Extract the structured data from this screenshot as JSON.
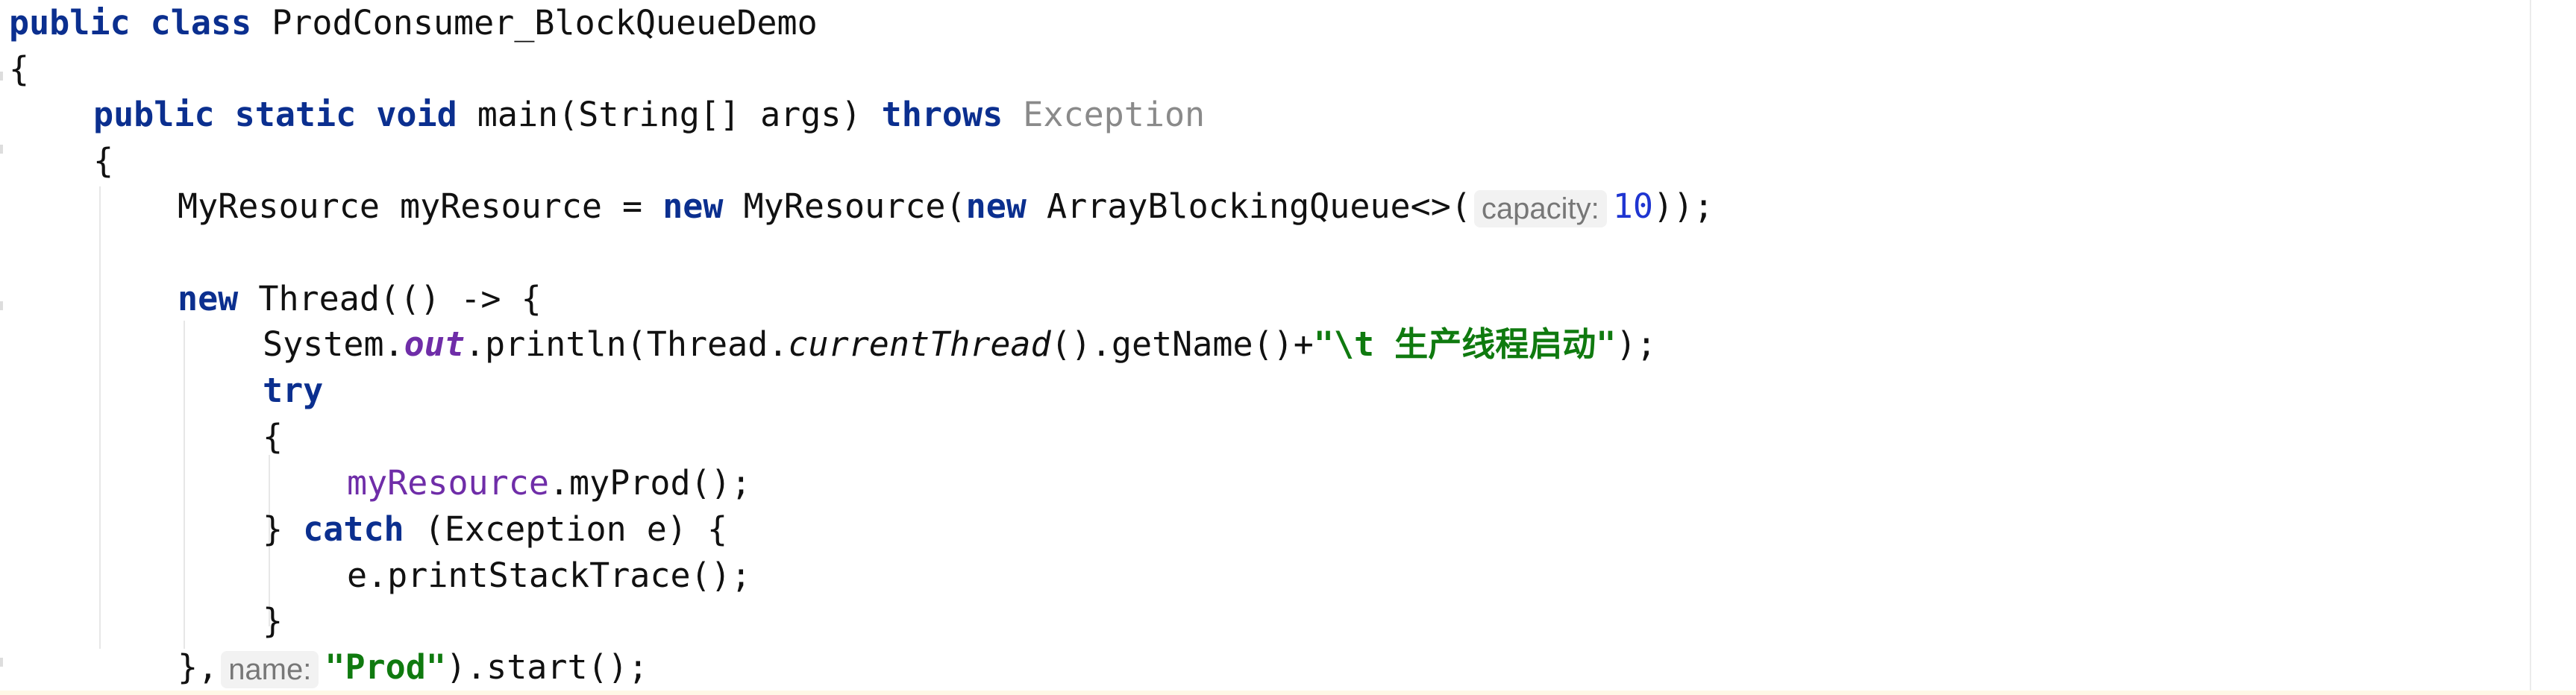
{
  "editor": {
    "class_decl": {
      "kw_public": "public",
      "kw_class": "class",
      "class_name": "ProdConsumer_BlockQueueDemo"
    },
    "open_brace": "{",
    "main_decl": {
      "kw_public": "public",
      "kw_static": "static",
      "kw_void": "void",
      "signature": "main(String[] args)",
      "kw_throws": "throws",
      "exception_type": "Exception"
    },
    "main_open_brace": "{",
    "resource_line": {
      "prefix": "MyResource myResource = ",
      "kw_new1": "new",
      "middle": " MyResource(",
      "kw_new2": "new",
      "queue_type": " ArrayBlockingQueue<>(",
      "hint_label": "capacity:",
      "capacity_value": "10",
      "suffix": "));"
    },
    "thread_line": {
      "kw_new": "new",
      "text": " Thread(() -> {"
    },
    "println_line": {
      "system": "System.",
      "out": "out",
      "println": ".println(Thread.",
      "current_thread": "currentThread",
      "get_name": "().getName()+",
      "string_open": "\"\\t ",
      "cjk_text": "生产线程启动",
      "string_close": "\"",
      "suffix": ");"
    },
    "try_line": "try",
    "try_open_brace": "{",
    "prod_call": {
      "field": "myResource",
      "method": ".myProd();"
    },
    "catch_line": {
      "prefix": "} ",
      "kw_catch": "catch",
      "suffix": " (Exception e) {"
    },
    "stacktrace_line": "e.printStackTrace();",
    "catch_close": "}",
    "thread_end": {
      "prefix": "},",
      "hint_label": "name:",
      "thread_name": "\"Prod\"",
      "suffix": ").start();"
    }
  }
}
